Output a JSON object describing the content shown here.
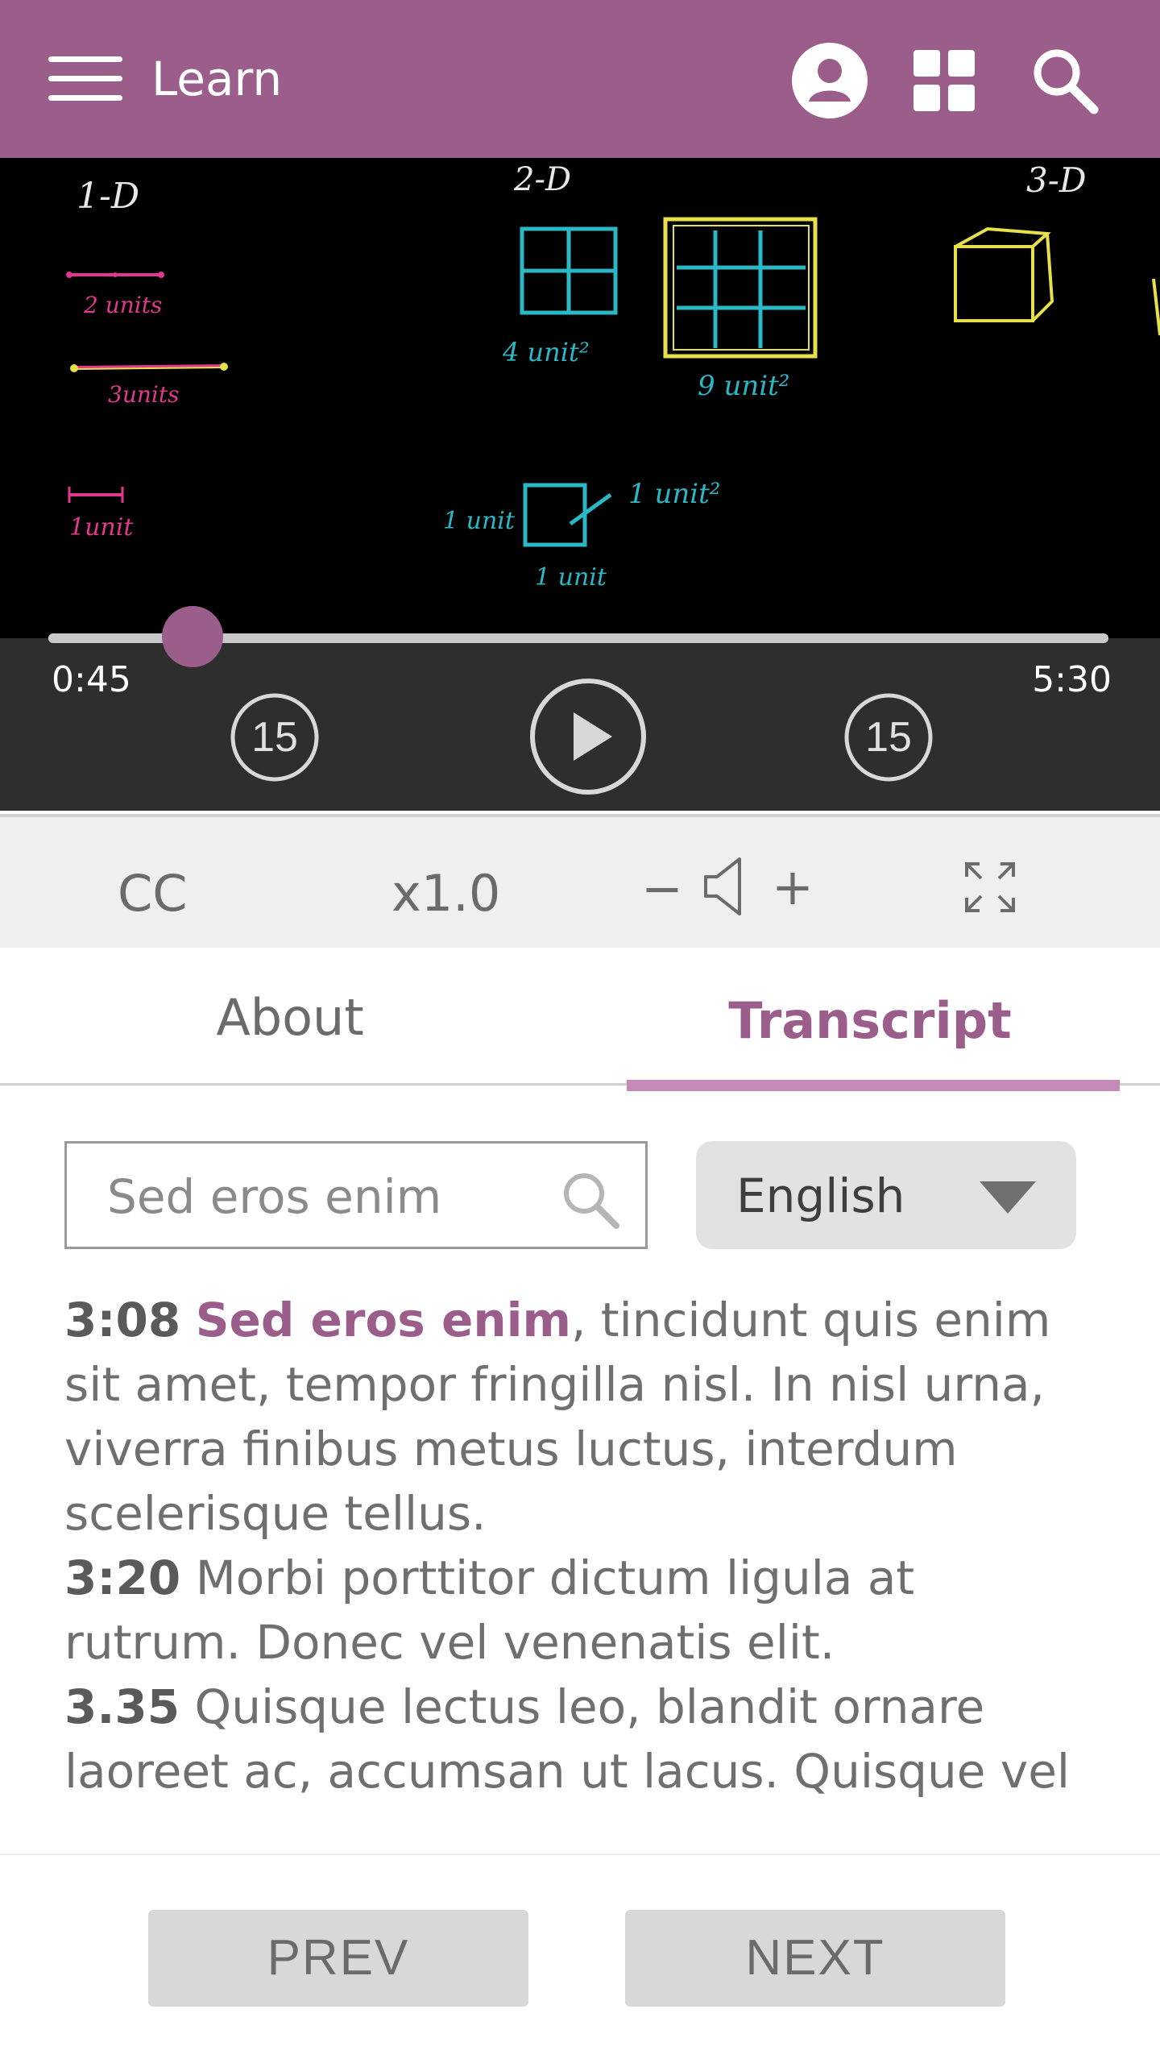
{
  "appbar": {
    "title": "Learn",
    "background": "#9b5e8a",
    "icons": [
      "menu-icon",
      "account-icon",
      "apps-grid-icon",
      "search-icon"
    ]
  },
  "video": {
    "board": {
      "col1_heading": "1-D",
      "col2_heading": "2-D",
      "col3_heading": "3-D",
      "label_2units": "2 units",
      "label_3units": "3units",
      "label_1unit": "1unit",
      "label_4unit2": "4 unit²",
      "label_9unit2": "9 unit²",
      "label_1unit2": "1 unit²",
      "label_side_left": "1 unit",
      "label_side_bottom": "1 unit"
    },
    "progress_fraction": 0.136,
    "elapsed": "0:45",
    "duration": "5:30",
    "rewind_seconds": "15",
    "forward_seconds": "15",
    "play_icon": "play-icon"
  },
  "toolbar": {
    "cc_label": "CC",
    "speed_label": "x1.0",
    "volume_minus": "−",
    "volume_plus": "+",
    "icons": [
      "volume-icon",
      "fullscreen-icon"
    ]
  },
  "tabs": {
    "about": "About",
    "transcript": "Transcript",
    "active": "transcript"
  },
  "search": {
    "placeholder": "Sed eros enim",
    "value": ""
  },
  "language": {
    "selected": "English"
  },
  "transcript": [
    {
      "time": "3:08",
      "highlight": "Sed eros enim",
      "text": ", tincidunt quis enim sit amet, tempor fringilla nisl. In nisl urna, viverra finibus metus luctus, interdum scelerisque tellus."
    },
    {
      "time": "3:20",
      "highlight": "",
      "text": " Morbi porttitor dictum ligula at rutrum. Donec vel venenatis elit."
    },
    {
      "time": "3.35",
      "highlight": "",
      "text": " Quisque lectus leo, blandit ornare laoreet ac, accumsan ut lacus. Quisque vel"
    }
  ],
  "nav": {
    "prev": "PREV",
    "next": "NEXT"
  }
}
